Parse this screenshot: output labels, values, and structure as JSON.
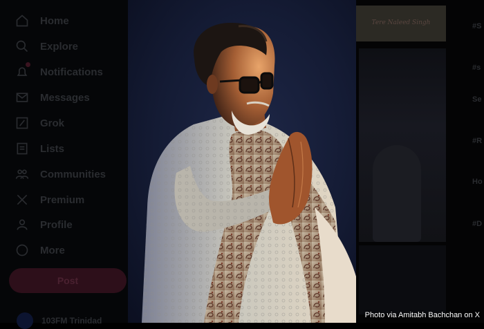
{
  "sidebar": {
    "items": [
      {
        "label": "Home",
        "icon": "home-icon"
      },
      {
        "label": "Explore",
        "icon": "search-icon"
      },
      {
        "label": "Notifications",
        "icon": "bell-icon"
      },
      {
        "label": "Messages",
        "icon": "mail-icon"
      },
      {
        "label": "Grok",
        "icon": "grok-icon"
      },
      {
        "label": "Lists",
        "icon": "list-icon"
      },
      {
        "label": "Communities",
        "icon": "people-icon"
      },
      {
        "label": "Premium",
        "icon": "x-logo-icon"
      },
      {
        "label": "Profile",
        "icon": "person-icon"
      },
      {
        "label": "More",
        "icon": "more-icon"
      }
    ],
    "post_label": "Post",
    "account_name": "103FM Trinidad"
  },
  "right_rail": {
    "snippets": [
      "#S",
      "#s",
      "Se",
      "#R",
      "Ho",
      "#D"
    ]
  },
  "thumb1_text": "Tere Naleed Singh",
  "caption": "Photo via Amitabh Bachchan on X",
  "colors": {
    "photo_background": "#141b34",
    "kurta": "#c9c7bd",
    "shawl": "#6b4a3a",
    "warm_light": "#d08850"
  }
}
